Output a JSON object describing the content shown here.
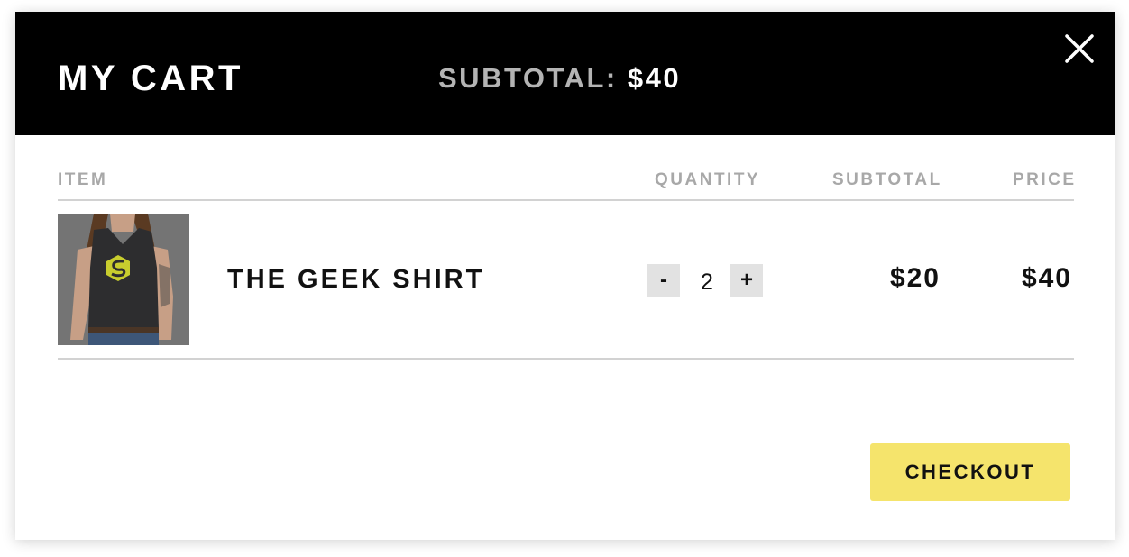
{
  "header": {
    "title": "MY CART",
    "subtotal_label": "SUBTOTAL:",
    "subtotal_value": "$40",
    "close_icon": "close-icon"
  },
  "table": {
    "columns": [
      "ITEM",
      "QUANTITY",
      "SUBTOTAL",
      "PRICE"
    ],
    "items": [
      {
        "image_icon": "product-image-tank-top",
        "name": "THE GEEK SHIRT",
        "decrement_label": "-",
        "quantity": "2",
        "increment_label": "+",
        "subtotal": "$20",
        "price": "$40"
      }
    ]
  },
  "actions": {
    "checkout_label": "CHECKOUT"
  },
  "colors": {
    "header_bg": "#000000",
    "accent_checkout": "#f5e46c",
    "muted_text": "#a8a8a8",
    "qty_button_bg": "#e2e2e2"
  }
}
